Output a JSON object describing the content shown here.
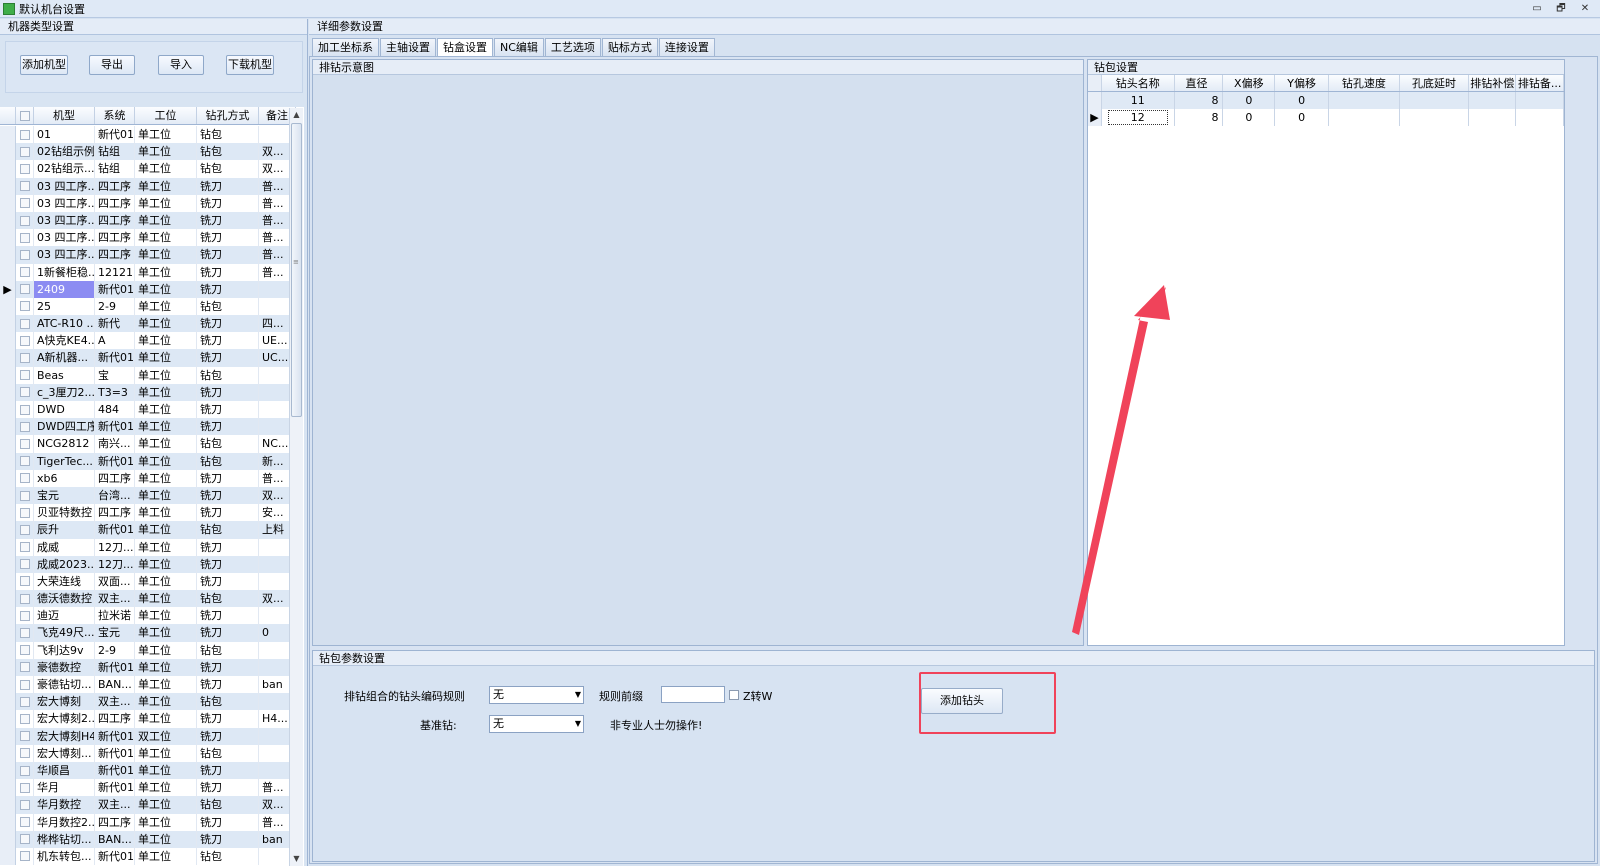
{
  "window": {
    "title": "默认机台设置",
    "controls": [
      "▭",
      "🗗",
      "✕"
    ]
  },
  "left": {
    "header": "机器类型设置",
    "buttons": {
      "add": "添加机型",
      "export": "导出",
      "import": "导入",
      "download": "下载机型"
    },
    "columns": {
      "name": "机型",
      "system": "系统",
      "position": "工位",
      "drill": "钻孔方式",
      "note": "备注"
    },
    "rows": [
      {
        "name": "01",
        "system": "新代01",
        "position": "单工位",
        "drill": "钻包",
        "note": ""
      },
      {
        "name": "02钻组示例",
        "system": "钻组",
        "position": "单工位",
        "drill": "钻包",
        "note": "双..."
      },
      {
        "name": "02钻组示...",
        "system": "钻组",
        "position": "单工位",
        "drill": "钻包",
        "note": "双..."
      },
      {
        "name": "03 四工序...",
        "system": "四工序",
        "position": "单工位",
        "drill": "铣刀",
        "note": "普..."
      },
      {
        "name": "03 四工序...",
        "system": "四工序",
        "position": "单工位",
        "drill": "铣刀",
        "note": "普..."
      },
      {
        "name": "03 四工序...",
        "system": "四工序",
        "position": "单工位",
        "drill": "铣刀",
        "note": "普..."
      },
      {
        "name": "03 四工序...",
        "system": "四工序",
        "position": "单工位",
        "drill": "铣刀",
        "note": "普..."
      },
      {
        "name": "03 四工序...",
        "system": "四工序",
        "position": "单工位",
        "drill": "铣刀",
        "note": "普..."
      },
      {
        "name": "1新餐柜稳...",
        "system": "12121",
        "position": "单工位",
        "drill": "铣刀",
        "note": "普..."
      },
      {
        "name": "2409",
        "system": "新代01",
        "position": "单工位",
        "drill": "铣刀",
        "note": ""
      },
      {
        "name": "25",
        "system": "2-9",
        "position": "单工位",
        "drill": "钻包",
        "note": ""
      },
      {
        "name": "ATC-R10 ...",
        "system": "新代",
        "position": "单工位",
        "drill": "铣刀",
        "note": "四..."
      },
      {
        "name": "A快克KE4...",
        "system": "A",
        "position": "单工位",
        "drill": "铣刀",
        "note": "UE..."
      },
      {
        "name": "A新机器...",
        "system": "新代01",
        "position": "单工位",
        "drill": "铣刀",
        "note": "UC..."
      },
      {
        "name": "Beas",
        "system": "宝",
        "position": "单工位",
        "drill": "钻包",
        "note": ""
      },
      {
        "name": "c_3厘刀2...",
        "system": "T3=3",
        "position": "单工位",
        "drill": "铣刀",
        "note": ""
      },
      {
        "name": "DWD",
        "system": "484",
        "position": "单工位",
        "drill": "铣刀",
        "note": ""
      },
      {
        "name": "DWD四工序",
        "system": "新代01",
        "position": "单工位",
        "drill": "铣刀",
        "note": ""
      },
      {
        "name": "NCG2812",
        "system": "南兴...",
        "position": "单工位",
        "drill": "钻包",
        "note": "NC..."
      },
      {
        "name": "TigerTec...",
        "system": "新代01",
        "position": "单工位",
        "drill": "钻包",
        "note": "新..."
      },
      {
        "name": "xb6",
        "system": "四工序",
        "position": "单工位",
        "drill": "铣刀",
        "note": "普..."
      },
      {
        "name": "宝元",
        "system": "台湾...",
        "position": "单工位",
        "drill": "铣刀",
        "note": "双..."
      },
      {
        "name": "贝亚特数控",
        "system": "四工序",
        "position": "单工位",
        "drill": "铣刀",
        "note": "安..."
      },
      {
        "name": "辰升",
        "system": "新代01",
        "position": "单工位",
        "drill": "钻包",
        "note": "上料"
      },
      {
        "name": "成威",
        "system": "12刀...",
        "position": "单工位",
        "drill": "铣刀",
        "note": ""
      },
      {
        "name": "成威2023...",
        "system": "12刀...",
        "position": "单工位",
        "drill": "铣刀",
        "note": ""
      },
      {
        "name": "大荣连线",
        "system": "双面...",
        "position": "单工位",
        "drill": "铣刀",
        "note": ""
      },
      {
        "name": "德沃德数控",
        "system": "双主...",
        "position": "单工位",
        "drill": "钻包",
        "note": "双..."
      },
      {
        "name": "迪迈",
        "system": "拉米诺",
        "position": "单工位",
        "drill": "铣刀",
        "note": ""
      },
      {
        "name": "飞克49尺...",
        "system": "宝元",
        "position": "单工位",
        "drill": "铣刀",
        "note": "0"
      },
      {
        "name": "飞利达9v",
        "system": "2-9",
        "position": "单工位",
        "drill": "钻包",
        "note": ""
      },
      {
        "name": "豪德数控",
        "system": "新代01",
        "position": "单工位",
        "drill": "铣刀",
        "note": ""
      },
      {
        "name": "豪德钻切...",
        "system": "BAN...",
        "position": "单工位",
        "drill": "铣刀",
        "note": "ban"
      },
      {
        "name": "宏大博刻",
        "system": "双主...",
        "position": "单工位",
        "drill": "钻包",
        "note": ""
      },
      {
        "name": "宏大博刻2...",
        "system": "四工序",
        "position": "单工位",
        "drill": "铣刀",
        "note": "H4..."
      },
      {
        "name": "宏大博刻H4",
        "system": "新代01",
        "position": "双工位",
        "drill": "铣刀",
        "note": ""
      },
      {
        "name": "宏大博刻...",
        "system": "新代01",
        "position": "单工位",
        "drill": "钻包",
        "note": ""
      },
      {
        "name": "华顺昌",
        "system": "新代01",
        "position": "单工位",
        "drill": "铣刀",
        "note": ""
      },
      {
        "name": "华月",
        "system": "新代01",
        "position": "单工位",
        "drill": "铣刀",
        "note": "普..."
      },
      {
        "name": "华月数控",
        "system": "双主...",
        "position": "单工位",
        "drill": "钻包",
        "note": "双..."
      },
      {
        "name": "华月数控2...",
        "system": "四工序",
        "position": "单工位",
        "drill": "铣刀",
        "note": "普..."
      },
      {
        "name": "桦桦钻切...",
        "system": "BAN...",
        "position": "单工位",
        "drill": "铣刀",
        "note": "ban"
      },
      {
        "name": "机东转包...",
        "system": "新代01",
        "position": "单工位",
        "drill": "钻包",
        "note": ""
      }
    ],
    "selected_row": "2409"
  },
  "right": {
    "header": "详细参数设置",
    "tabs": [
      "加工坐标系",
      "主轴设置",
      "钻盒设置",
      "NC编辑",
      "工艺选项",
      "贴标方式",
      "连接设置"
    ],
    "active_tab": "钻盒设置",
    "layout_header": "排钻示意图",
    "drillbox": {
      "header": "钻包设置",
      "columns": [
        "钻头名称",
        "直径",
        "X偏移",
        "Y偏移",
        "钻孔速度",
        "孔底延时",
        "排钻补偿",
        "排钻备..."
      ],
      "rows": [
        {
          "name": "11",
          "dia": "8",
          "x": "0",
          "y": "0"
        },
        {
          "name": "12",
          "dia": "8",
          "x": "0",
          "y": "0"
        }
      ]
    },
    "params": {
      "header": "钻包参数设置",
      "rule_label": "排钻组合的钻头编码规则",
      "rule_value": "无",
      "prefix_label": "规则前缀",
      "prefix_value": "",
      "z_label": "Z转W",
      "base_label": "基准钻:",
      "base_value": "无",
      "warning": "非专业人士勿操作!",
      "add_button": "添加钻头"
    }
  },
  "colors": {
    "annotation": "#f0435a",
    "selected": "#8c8cf2"
  }
}
